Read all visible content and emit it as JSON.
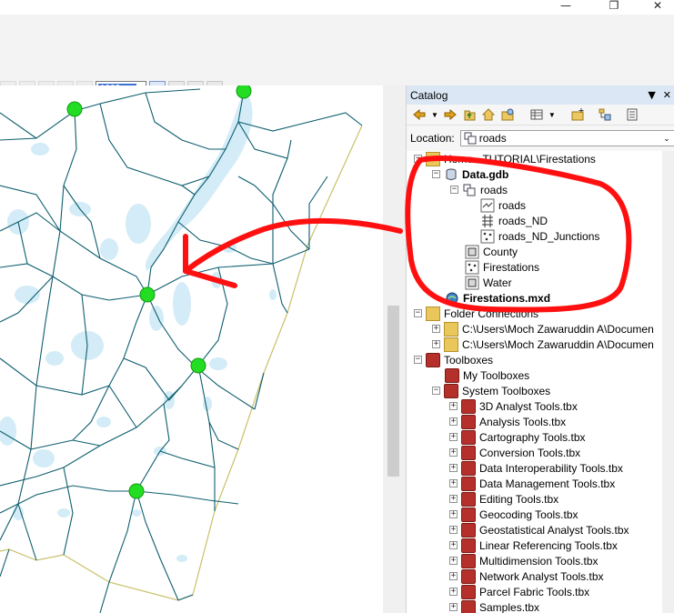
{
  "window": {
    "controls": [
      "minimize",
      "restore",
      "close"
    ]
  },
  "toolbar": {
    "scale_value": "1002"
  },
  "catalog": {
    "title": "Catalog",
    "location_label": "Location:",
    "location_value": "roads",
    "tree": [
      {
        "label": "Home - TUTORIAL\\Firestations",
        "icon": "home-folder-icon"
      },
      {
        "label": "Data.gdb",
        "icon": "geodatabase-icon"
      },
      {
        "label": "roads",
        "icon": "feature-dataset-icon"
      },
      {
        "label": "roads",
        "icon": "line-feature-class-icon"
      },
      {
        "label": "roads_ND",
        "icon": "network-dataset-icon"
      },
      {
        "label": "roads_ND_Junctions",
        "icon": "point-feature-class-icon"
      },
      {
        "label": "County",
        "icon": "polygon-feature-class-icon"
      },
      {
        "label": "Firestations",
        "icon": "point-feature-class-icon"
      },
      {
        "label": "Water",
        "icon": "polygon-feature-class-icon"
      },
      {
        "label": "Firestations.mxd",
        "icon": "map-document-icon"
      },
      {
        "label": "Folder Connections",
        "icon": "folder-connections-icon"
      },
      {
        "label": "C:\\Users\\Moch Zawaruddin A\\Documen",
        "icon": "folder-icon"
      },
      {
        "label": "C:\\Users\\Moch Zawaruddin A\\Documen",
        "icon": "folder-icon"
      },
      {
        "label": "Toolboxes",
        "icon": "toolboxes-icon"
      },
      {
        "label": "My Toolboxes",
        "icon": "toolboxes-icon"
      },
      {
        "label": "System Toolboxes",
        "icon": "toolboxes-icon"
      },
      {
        "label": "3D Analyst Tools.tbx",
        "icon": "toolbox-icon"
      },
      {
        "label": "Analysis Tools.tbx",
        "icon": "toolbox-icon"
      },
      {
        "label": "Cartography Tools.tbx",
        "icon": "toolbox-icon"
      },
      {
        "label": "Conversion Tools.tbx",
        "icon": "toolbox-icon"
      },
      {
        "label": "Data Interoperability Tools.tbx",
        "icon": "toolbox-icon"
      },
      {
        "label": "Data Management Tools.tbx",
        "icon": "toolbox-icon"
      },
      {
        "label": "Editing Tools.tbx",
        "icon": "toolbox-icon"
      },
      {
        "label": "Geocoding Tools.tbx",
        "icon": "toolbox-icon"
      },
      {
        "label": "Geostatistical Analyst Tools.tbx",
        "icon": "toolbox-icon"
      },
      {
        "label": "Linear Referencing Tools.tbx",
        "icon": "toolbox-icon"
      },
      {
        "label": "Multidimension Tools.tbx",
        "icon": "toolbox-icon"
      },
      {
        "label": "Network Analyst Tools.tbx",
        "icon": "toolbox-icon"
      },
      {
        "label": "Parcel Fabric Tools.tbx",
        "icon": "toolbox-icon"
      },
      {
        "label": "Samples.tbx",
        "icon": "toolbox-icon"
      }
    ]
  },
  "colors": {
    "road": "#0d5e6e",
    "water": "#d3ecf7",
    "station": "#22dd22",
    "boundary": "#c9c06a",
    "annotation": "#ff1010",
    "panel_header": "#dce7f5"
  }
}
